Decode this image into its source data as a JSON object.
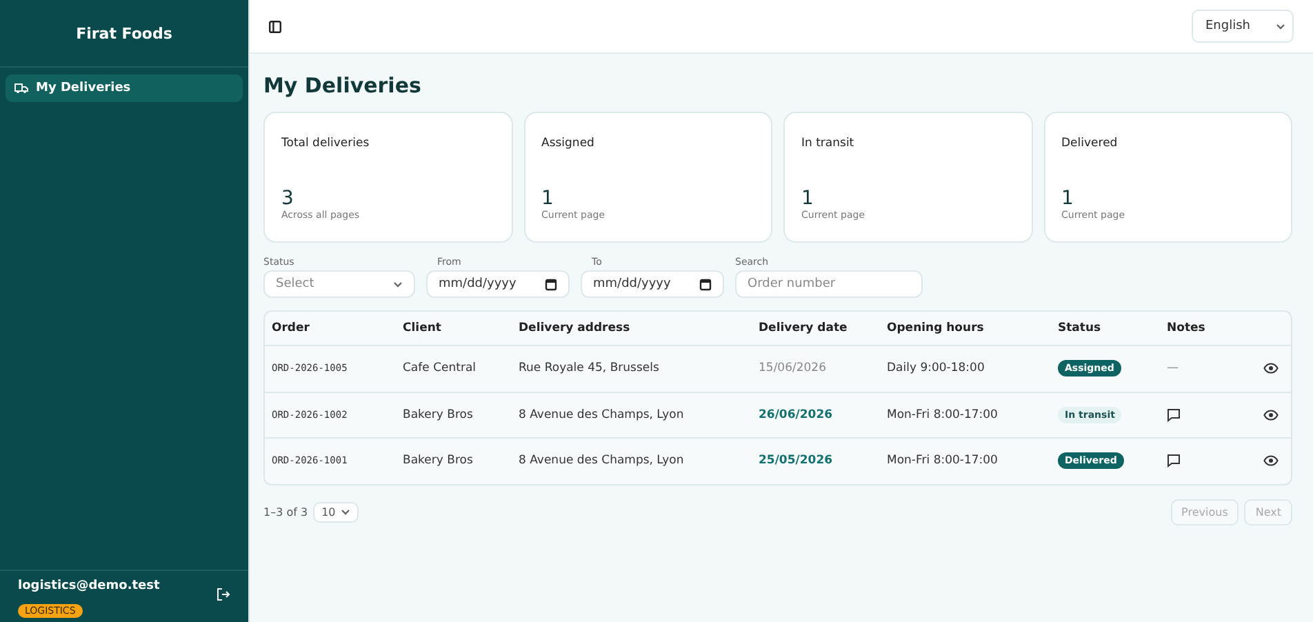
{
  "sidebar": {
    "brand": "Firat Foods",
    "items": [
      {
        "label": "My Deliveries",
        "selected": true
      }
    ],
    "user": {
      "email": "logistics@demo.test",
      "role": "LOGISTICS"
    }
  },
  "topbar": {
    "language": "English"
  },
  "page": {
    "title": "My Deliveries"
  },
  "stats": [
    {
      "title": "Total deliveries",
      "value": "3",
      "caption": "Across all pages"
    },
    {
      "title": "Assigned",
      "value": "1",
      "caption": "Current page"
    },
    {
      "title": "In transit",
      "value": "1",
      "caption": "Current page"
    },
    {
      "title": "Delivered",
      "value": "1",
      "caption": "Current page"
    }
  ],
  "filters": {
    "status": {
      "label": "Status",
      "placeholder": "Select"
    },
    "from": {
      "label": "From",
      "placeholder": "mm/dd/yyyy"
    },
    "to": {
      "label": "To",
      "placeholder": "mm/dd/yyyy"
    },
    "search": {
      "label": "Search",
      "placeholder": "Order number"
    }
  },
  "table": {
    "columns": [
      "Order",
      "Client",
      "Delivery address",
      "Delivery date",
      "Opening hours",
      "Status",
      "Notes"
    ],
    "rows": [
      {
        "order": "ORD-2026-1005",
        "client": "Cafe Central",
        "address": "Rue Royale 45, Brussels",
        "date": "15/06/2026",
        "date_highlighted": false,
        "hours": "Daily 9:00-18:00",
        "status": {
          "label": "Assigned",
          "kind": "solid"
        },
        "notes": {
          "kind": "none",
          "text": "—"
        }
      },
      {
        "order": "ORD-2026-1002",
        "client": "Bakery Bros",
        "address": "8 Avenue des Champs, Lyon",
        "date": "26/06/2026",
        "date_highlighted": true,
        "hours": "Mon-Fri 8:00-17:00",
        "status": {
          "label": "In transit",
          "kind": "soft"
        },
        "notes": {
          "kind": "note"
        }
      },
      {
        "order": "ORD-2026-1001",
        "client": "Bakery Bros",
        "address": "8 Avenue des Champs, Lyon",
        "date": "25/05/2026",
        "date_highlighted": true,
        "hours": "Mon-Fri 8:00-17:00",
        "status": {
          "label": "Delivered",
          "kind": "solid"
        },
        "notes": {
          "kind": "note"
        }
      }
    ]
  },
  "pagination": {
    "range": "1–3 of 3",
    "page_size": "10",
    "previous": {
      "label": "Previous",
      "disabled": true
    },
    "next": {
      "label": "Next",
      "disabled": true
    }
  }
}
